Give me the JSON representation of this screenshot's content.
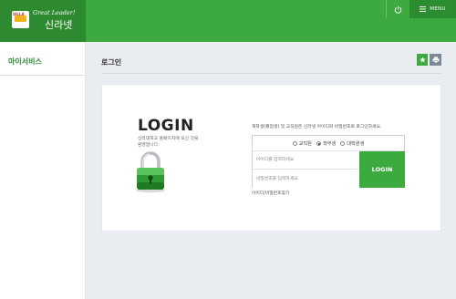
{
  "header": {
    "logo_text": "SILLA",
    "slogan": "Great Leader!",
    "brand_name": "신라넷",
    "menu_label": "MENU",
    "accent_color": "#3daa3f",
    "dark_color": "#2e8a31"
  },
  "sidebar": {
    "title": "마이서비스"
  },
  "page": {
    "title": "로그인"
  },
  "login": {
    "heading": "LOGIN",
    "welcome": "신라대학교 홈페이지에 오신 것을 환영합니다.",
    "notice": "재학생(졸업생) 및 교직원은 신라넷 아이디와 비밀번호로 로그인하세요.",
    "roles": [
      {
        "label": "교직원",
        "selected": false
      },
      {
        "label": "학부생",
        "selected": true
      },
      {
        "label": "대학원생",
        "selected": false
      }
    ],
    "id_placeholder": "아이디를 입력하세요",
    "pw_placeholder": "비밀번호를 입력하세요",
    "button_label": "LOGIN",
    "find_link": "아이디/비밀번호찾기"
  },
  "icons": {
    "power": "power-icon",
    "menu": "hamburger-icon",
    "star": "star-icon",
    "print": "print-icon",
    "lock": "padlock-icon"
  }
}
